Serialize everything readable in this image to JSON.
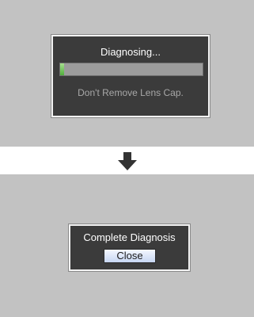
{
  "step1": {
    "title": "Diagnosing...",
    "progress": 0.03,
    "message": "Don't Remove Lens Cap.",
    "progress_color": "#4fae3c"
  },
  "transition_icon": "down-arrow-icon",
  "step2": {
    "title": "Complete Diagnosis",
    "close_label": "Close"
  }
}
